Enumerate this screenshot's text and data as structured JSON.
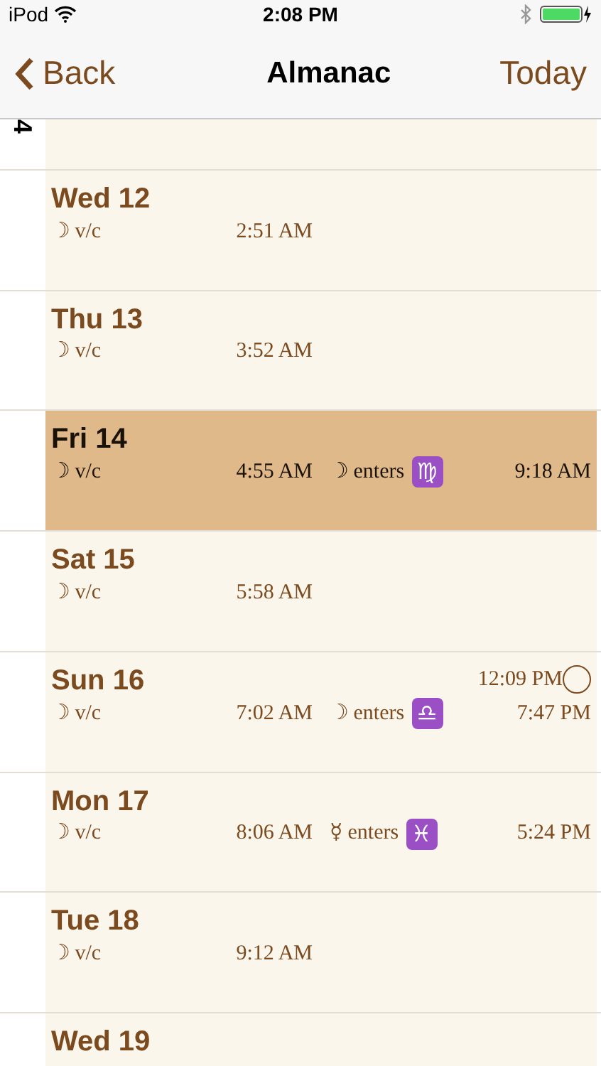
{
  "status_bar": {
    "device": "iPod",
    "time": "2:08 PM",
    "battery": {
      "level": 1,
      "charging": true
    }
  },
  "nav": {
    "back": "Back",
    "title": "Almanac",
    "action": "Today"
  },
  "month_marker": "4",
  "days": [
    {
      "label": "Wed 12",
      "selected": false,
      "void": {
        "symbol": "☽",
        "text": "v/c",
        "time": "2:51 AM"
      }
    },
    {
      "label": "Thu 13",
      "selected": false,
      "void": {
        "symbol": "☽",
        "text": "v/c",
        "time": "3:52 AM"
      }
    },
    {
      "label": "Fri 14",
      "selected": true,
      "void": {
        "symbol": "☽",
        "text": "v/c",
        "time": "4:55 AM"
      },
      "ingress": {
        "planet": "☽",
        "text": "enters",
        "sign": "♍",
        "time": "9:18 AM"
      }
    },
    {
      "label": "Sat 15",
      "selected": false,
      "void": {
        "symbol": "☽",
        "text": "v/c",
        "time": "5:58 AM"
      }
    },
    {
      "label": "Sun 16",
      "selected": false,
      "phase": {
        "time": "12:09 PM",
        "kind": "full"
      },
      "void": {
        "symbol": "☽",
        "text": "v/c",
        "time": "7:02 AM"
      },
      "ingress": {
        "planet": "☽",
        "text": "enters",
        "sign": "♎",
        "time": "7:47 PM"
      }
    },
    {
      "label": "Mon 17",
      "selected": false,
      "void": {
        "symbol": "☽",
        "text": "v/c",
        "time": "8:06 AM"
      },
      "ingress": {
        "planet": "☿",
        "text": "enters",
        "sign": "♓",
        "time": "5:24 PM"
      }
    },
    {
      "label": "Tue 18",
      "selected": false,
      "void": {
        "symbol": "☽",
        "text": "v/c",
        "time": "9:12 AM"
      }
    },
    {
      "label": "Wed 19",
      "selected": false
    }
  ]
}
